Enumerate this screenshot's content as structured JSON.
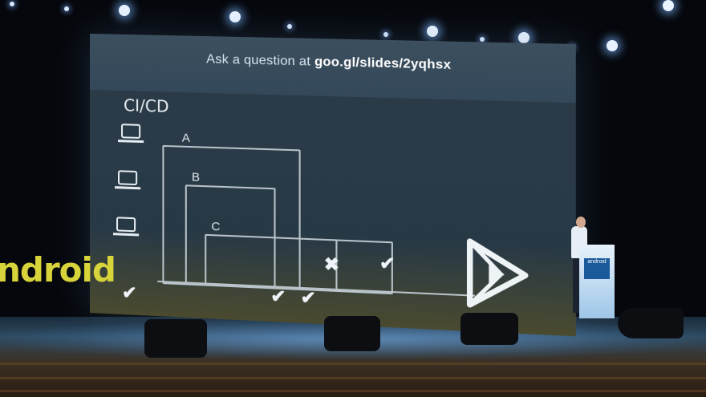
{
  "slide": {
    "header_prefix": "Ask a question at ",
    "header_link": "goo.gl/slides/2yqhsx",
    "title": "CI/CD",
    "box_labels": [
      "A",
      "B",
      "C"
    ],
    "pass_mark": "✔",
    "fail_mark": "✖"
  },
  "stage_branding": {
    "logo_text": "ndroid"
  },
  "podium": {
    "sign_text": "android"
  },
  "icons": [
    "laptop-icon",
    "play-store-icon",
    "checkmark-icon",
    "cross-icon"
  ],
  "colors": {
    "slide_background": "#2a3a48",
    "slide_header": "#33485a",
    "line_color": "#b9c3c9",
    "logo_color": "#d7d33a",
    "podium_color": "#cfe4f6"
  }
}
